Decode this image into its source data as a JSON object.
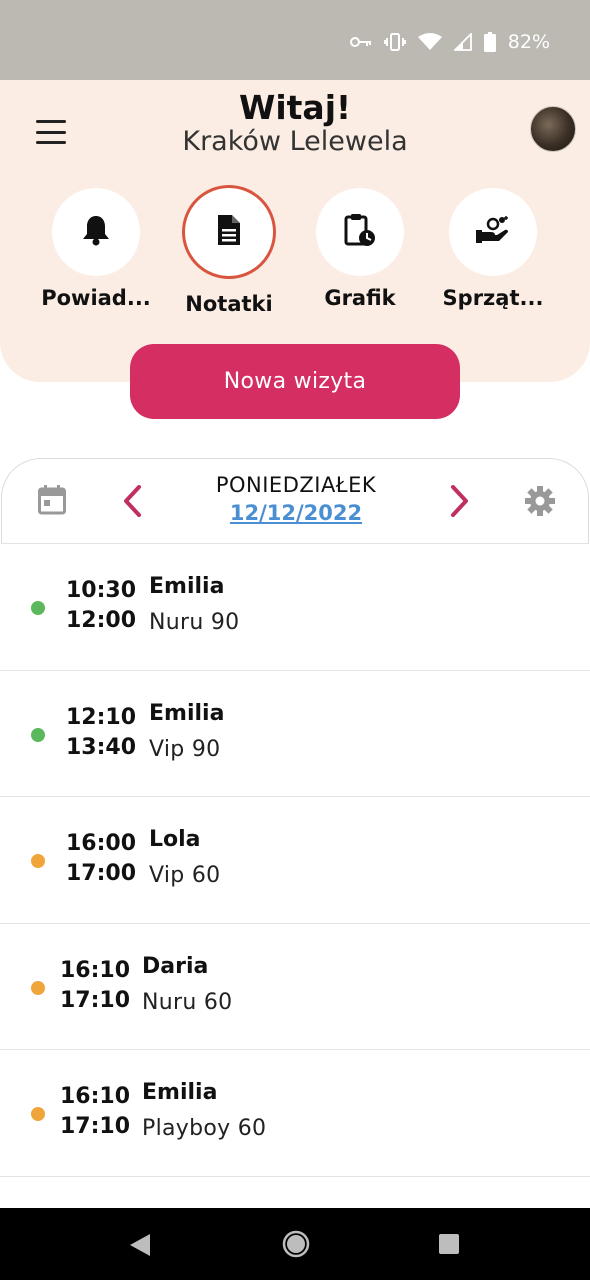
{
  "status_bar": {
    "battery_percent": "82%",
    "icons": [
      "key-icon",
      "vibrate-icon",
      "wifi-icon",
      "signal-icon",
      "battery-icon"
    ]
  },
  "header": {
    "title": "Witaj!",
    "location": "Kraków Lelewela",
    "actions": [
      {
        "label": "Powiad...",
        "icon": "bell-icon",
        "active": false
      },
      {
        "label": "Notatki",
        "icon": "document-icon",
        "active": true
      },
      {
        "label": "Grafik",
        "icon": "clipboard-clock-icon",
        "active": false
      },
      {
        "label": "Sprząt...",
        "icon": "cleaning-hand-icon",
        "active": false
      }
    ],
    "new_visit_label": "Nowa wizyta"
  },
  "date_nav": {
    "day": "PONIEDZIAŁEK",
    "date": "12/12/2022"
  },
  "appointments": [
    {
      "start": "10:30",
      "end": "12:00",
      "client": "Emilia",
      "service": "Nuru 90",
      "status_color": "#5cb85c"
    },
    {
      "start": "12:10",
      "end": "13:40",
      "client": "Emilia",
      "service": "Vip 90",
      "status_color": "#5cb85c"
    },
    {
      "start": "16:00",
      "end": "17:00",
      "client": "Lola",
      "service": "Vip 60",
      "status_color": "#f0a53a"
    },
    {
      "start": "16:10",
      "end": "17:10",
      "client": "Daria",
      "service": "Nuru 60",
      "status_color": "#f0a53a"
    },
    {
      "start": "16:10",
      "end": "17:10",
      "client": "Emilia",
      "service": "Playboy 60",
      "status_color": "#f0a53a"
    }
  ],
  "colors": {
    "accent": "#d42e63",
    "header_bg": "#fbede3",
    "active_ring": "#d9553f",
    "date_link": "#4a8fd3",
    "arrow": "#c0305e"
  }
}
